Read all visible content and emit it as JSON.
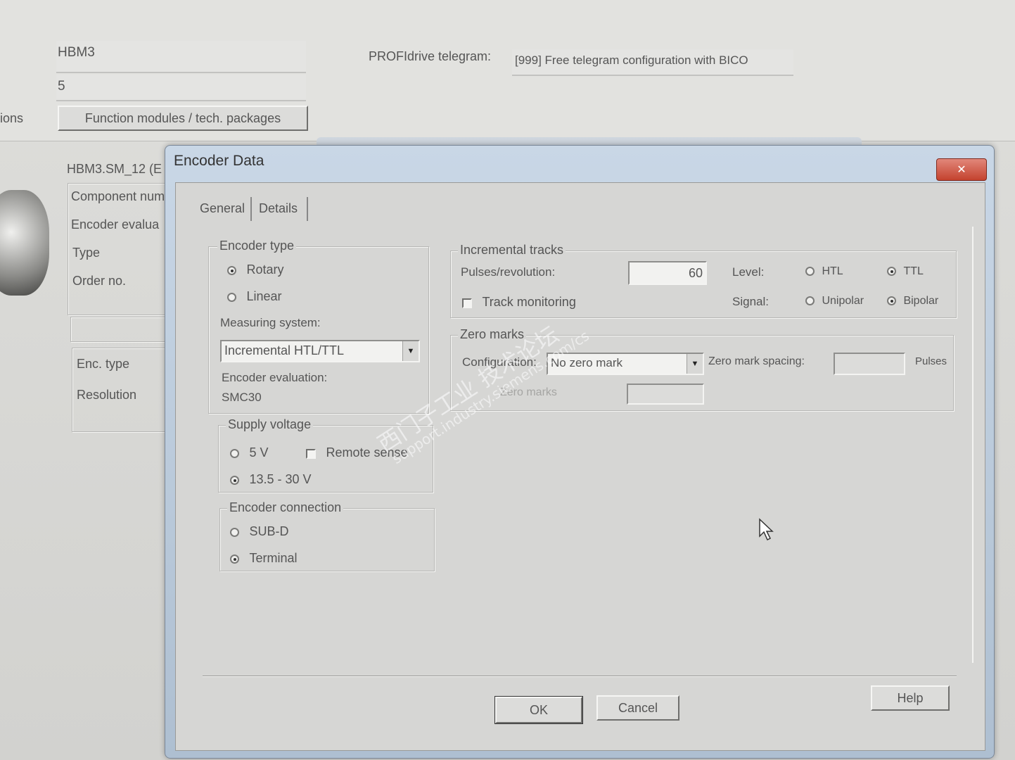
{
  "background": {
    "name_value": "HBM3",
    "number_value": "5",
    "cutoff_label": "ions",
    "function_modules_button": "Function modules / tech. packages",
    "telegram_label": "PROFIdrive telegram:",
    "telegram_value": "[999] Free telegram configuration with BICO",
    "motor_encoder_title": "HBM3.SM_12 (E",
    "left_rows": [
      "Component num",
      "Encoder evalua",
      "Type",
      "Order no."
    ],
    "left_rows2": [
      "Enc. type",
      "Resolution"
    ]
  },
  "dialog": {
    "title": "Encoder Data",
    "close_glyph": "✕",
    "tabs": [
      {
        "label": "General",
        "active": true
      },
      {
        "label": "Details",
        "active": false
      }
    ],
    "encoder_type": {
      "legend": "Encoder type",
      "options": [
        {
          "label": "Rotary",
          "selected": true
        },
        {
          "label": "Linear",
          "selected": false
        }
      ],
      "measuring_system_label": "Measuring system:",
      "measuring_system_value": "Incremental HTL/TTL",
      "encoder_evaluation_label": "Encoder evaluation:",
      "encoder_evaluation_value": "SMC30"
    },
    "supply_voltage": {
      "legend": "Supply voltage",
      "option_5v": {
        "label": "5 V",
        "selected": false
      },
      "remote_sense": {
        "label": "Remote sense",
        "checked": false
      },
      "option_13v": {
        "label": "13.5 - 30 V",
        "selected": true
      }
    },
    "encoder_connection": {
      "legend": "Encoder connection",
      "options": [
        {
          "label": "SUB-D",
          "selected": false
        },
        {
          "label": "Terminal",
          "selected": true
        }
      ]
    },
    "incremental_tracks": {
      "legend": "Incremental tracks",
      "pulses_label": "Pulses/revolution:",
      "pulses_value": "60",
      "level_label": "Level:",
      "level_htl": {
        "label": "HTL",
        "selected": false
      },
      "level_ttl": {
        "label": "TTL",
        "selected": true
      },
      "track_monitoring": {
        "label": "Track monitoring",
        "checked": false
      },
      "signal_label": "Signal:",
      "signal_unipolar": {
        "label": "Unipolar",
        "selected": false
      },
      "signal_bipolar": {
        "label": "Bipolar",
        "selected": true
      }
    },
    "zero_marks": {
      "legend": "Zero marks",
      "configuration_label": "Configuration:",
      "configuration_value": "No zero mark",
      "spacing_label": "Zero mark spacing:",
      "spacing_value": "",
      "spacing_unit": "Pulses",
      "count_label": "Zero marks",
      "count_value": ""
    },
    "buttons": {
      "ok": "OK",
      "cancel": "Cancel",
      "help": "Help"
    }
  },
  "watermark": {
    "line1": "西门子工业   技术论坛",
    "line2": "support.industry.siemens.com/cs"
  }
}
